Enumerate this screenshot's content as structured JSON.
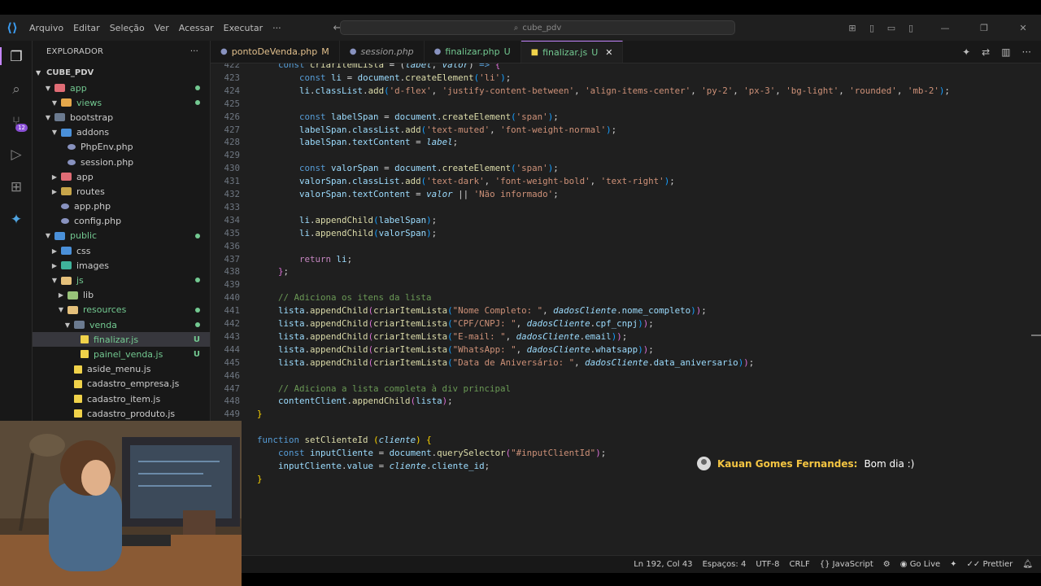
{
  "window": {
    "menu": [
      "Arquivo",
      "Editar",
      "Seleção",
      "Ver",
      "Acessar",
      "Executar",
      "···"
    ],
    "search_text": "cube_pdv"
  },
  "activity_bar": {
    "source_control_badge": "12",
    "icons": [
      "explorer-icon",
      "search-icon",
      "source-control-icon",
      "run-debug-icon",
      "extensions-icon",
      "copilot-icon"
    ]
  },
  "sidebar": {
    "title": "EXPLORADOR",
    "more": "···",
    "root": "CUBE_PDV",
    "items": [
      {
        "label": "app",
        "depth": 1,
        "type": "folder-open",
        "color": "#e06c75",
        "git": true,
        "status": "dot"
      },
      {
        "label": "views",
        "depth": 2,
        "type": "folder-open",
        "color": "#e5a84b",
        "git": true,
        "status": "dot"
      },
      {
        "label": "bootstrap",
        "depth": 1,
        "type": "folder-open",
        "color": "#6b7a8f",
        "git": false,
        "status": ""
      },
      {
        "label": "addons",
        "depth": 2,
        "type": "folder-open",
        "color": "#4a90d9",
        "git": false,
        "status": ""
      },
      {
        "label": "PhpEnv.php",
        "depth": 3,
        "type": "php",
        "color": "#8892bf",
        "git": false,
        "status": ""
      },
      {
        "label": "session.php",
        "depth": 3,
        "type": "php",
        "color": "#8892bf",
        "git": false,
        "status": ""
      },
      {
        "label": "app",
        "depth": 2,
        "type": "folder",
        "color": "#e06c75",
        "git": false,
        "status": ""
      },
      {
        "label": "routes",
        "depth": 2,
        "type": "folder",
        "color": "#c7a54a",
        "git": false,
        "status": ""
      },
      {
        "label": "app.php",
        "depth": 2,
        "type": "php",
        "color": "#8892bf",
        "git": false,
        "status": ""
      },
      {
        "label": "config.php",
        "depth": 2,
        "type": "php",
        "color": "#8892bf",
        "git": false,
        "status": ""
      },
      {
        "label": "public",
        "depth": 1,
        "type": "folder-open",
        "color": "#4a90d9",
        "git": true,
        "status": "dot"
      },
      {
        "label": "css",
        "depth": 2,
        "type": "folder",
        "color": "#4a90d9",
        "git": false,
        "status": ""
      },
      {
        "label": "images",
        "depth": 2,
        "type": "folder",
        "color": "#3fb39b",
        "git": false,
        "status": ""
      },
      {
        "label": "js",
        "depth": 2,
        "type": "folder-open",
        "color": "#e5c07b",
        "git": true,
        "status": "dot"
      },
      {
        "label": "lib",
        "depth": 3,
        "type": "folder",
        "color": "#98c379",
        "git": false,
        "status": ""
      },
      {
        "label": "resources",
        "depth": 3,
        "type": "folder-open",
        "color": "#e5c07b",
        "git": true,
        "status": "dot"
      },
      {
        "label": "venda",
        "depth": 4,
        "type": "folder-open",
        "color": "#6b7a8f",
        "git": true,
        "status": "dot"
      },
      {
        "label": "finalizar.js",
        "depth": 5,
        "type": "js",
        "color": "#f0d24a",
        "git": true,
        "status": "U",
        "selected": true
      },
      {
        "label": "painel_venda.js",
        "depth": 5,
        "type": "js",
        "color": "#f0d24a",
        "git": true,
        "status": "U"
      },
      {
        "label": "aside_menu.js",
        "depth": 4,
        "type": "js",
        "color": "#f0d24a",
        "git": false,
        "status": ""
      },
      {
        "label": "cadastro_empresa.js",
        "depth": 4,
        "type": "js",
        "color": "#f0d24a",
        "git": false,
        "status": ""
      },
      {
        "label": "cadastro_item.js",
        "depth": 4,
        "type": "js",
        "color": "#f0d24a",
        "git": false,
        "status": ""
      },
      {
        "label": "cadastro_produto.js",
        "depth": 4,
        "type": "js",
        "color": "#f0d24a",
        "git": false,
        "status": ""
      }
    ]
  },
  "tabs": [
    {
      "label": "pontoDeVenda.php",
      "status": "M",
      "italic": false,
      "active": false,
      "icon_color": "#8892bf"
    },
    {
      "label": "session.php",
      "status": "",
      "italic": true,
      "active": false,
      "icon_color": "#8892bf"
    },
    {
      "label": "finalizar.php",
      "status": "U",
      "italic": false,
      "active": false,
      "icon_color": "#8892bf"
    },
    {
      "label": "finalizar.js",
      "status": "U",
      "italic": false,
      "active": true,
      "icon_color": "#f0d24a",
      "close": "✕"
    }
  ],
  "code": [
    {
      "n": "422",
      "html": "    <span class=\"kw\">const</span> <span class=\"fn\">criarItemLista</span> <span class=\"pl\">= (</span><span class=\"it\">label</span><span class=\"pl\">, </span><span class=\"it\">valor</span><span class=\"pl\">) </span><span class=\"kw\">=&gt;</span> <span class=\"br2\">{</span>"
    },
    {
      "n": "423",
      "html": "        <span class=\"kw\">const</span> <span class=\"var\">li</span> <span class=\"pl\">=</span> <span class=\"var\">document</span><span class=\"pl\">.</span><span class=\"fn\">createElement</span><span class=\"br3\">(</span><span class=\"str\">'li'</span><span class=\"br3\">)</span><span class=\"pl\">;</span>"
    },
    {
      "n": "424",
      "html": "        <span class=\"var\">li</span><span class=\"pl\">.</span><span class=\"var\">classList</span><span class=\"pl\">.</span><span class=\"fn\">add</span><span class=\"br3\">(</span><span class=\"str\">'d-flex'</span><span class=\"pl\">, </span><span class=\"str\">'justify-content-between'</span><span class=\"pl\">, </span><span class=\"str\">'align-items-center'</span><span class=\"pl\">, </span><span class=\"str\">'py-2'</span><span class=\"pl\">, </span><span class=\"str\">'px-3'</span><span class=\"pl\">, </span><span class=\"str\">'bg-light'</span><span class=\"pl\">, </span><span class=\"str\">'rounded'</span><span class=\"pl\">, </span><span class=\"str\">'mb-2'</span><span class=\"br3\">)</span><span class=\"pl\">;</span>"
    },
    {
      "n": "425",
      "html": ""
    },
    {
      "n": "426",
      "html": "        <span class=\"kw\">const</span> <span class=\"var\">labelSpan</span> <span class=\"pl\">=</span> <span class=\"var\">document</span><span class=\"pl\">.</span><span class=\"fn\">createElement</span><span class=\"br3\">(</span><span class=\"str\">'span'</span><span class=\"br3\">)</span><span class=\"pl\">;</span>"
    },
    {
      "n": "427",
      "html": "        <span class=\"var\">labelSpan</span><span class=\"pl\">.</span><span class=\"var\">classList</span><span class=\"pl\">.</span><span class=\"fn\">add</span><span class=\"br3\">(</span><span class=\"str\">'text-muted'</span><span class=\"pl\">, </span><span class=\"str\">'font-weight-normal'</span><span class=\"br3\">)</span><span class=\"pl\">;</span>"
    },
    {
      "n": "428",
      "html": "        <span class=\"var\">labelSpan</span><span class=\"pl\">.</span><span class=\"var\">textContent</span> <span class=\"pl\">=</span> <span class=\"it\">label</span><span class=\"pl\">;</span>"
    },
    {
      "n": "429",
      "html": ""
    },
    {
      "n": "430",
      "html": "        <span class=\"kw\">const</span> <span class=\"var\">valorSpan</span> <span class=\"pl\">=</span> <span class=\"var\">document</span><span class=\"pl\">.</span><span class=\"fn\">createElement</span><span class=\"br3\">(</span><span class=\"str\">'span'</span><span class=\"br3\">)</span><span class=\"pl\">;</span>"
    },
    {
      "n": "431",
      "html": "        <span class=\"var\">valorSpan</span><span class=\"pl\">.</span><span class=\"var\">classList</span><span class=\"pl\">.</span><span class=\"fn\">add</span><span class=\"br3\">(</span><span class=\"str\">'text-dark'</span><span class=\"pl\">, </span><span class=\"str\">'font-weight-bold'</span><span class=\"pl\">, </span><span class=\"str\">'text-right'</span><span class=\"br3\">)</span><span class=\"pl\">;</span>"
    },
    {
      "n": "432",
      "html": "        <span class=\"var\">valorSpan</span><span class=\"pl\">.</span><span class=\"var\">textContent</span> <span class=\"pl\">=</span> <span class=\"it\">valor</span> <span class=\"pl\">||</span> <span class=\"str\">'Não informado'</span><span class=\"pl\">;</span>"
    },
    {
      "n": "433",
      "html": ""
    },
    {
      "n": "434",
      "html": "        <span class=\"var\">li</span><span class=\"pl\">.</span><span class=\"fn\">appendChild</span><span class=\"br3\">(</span><span class=\"var\">labelSpan</span><span class=\"br3\">)</span><span class=\"pl\">;</span>"
    },
    {
      "n": "435",
      "html": "        <span class=\"var\">li</span><span class=\"pl\">.</span><span class=\"fn\">appendChild</span><span class=\"br3\">(</span><span class=\"var\">valorSpan</span><span class=\"br3\">)</span><span class=\"pl\">;</span>"
    },
    {
      "n": "436",
      "html": ""
    },
    {
      "n": "437",
      "html": "        <span class=\"ctl\">return</span> <span class=\"var\">li</span><span class=\"pl\">;</span>"
    },
    {
      "n": "438",
      "html": "    <span class=\"br2\">}</span><span class=\"pl\">;</span>"
    },
    {
      "n": "439",
      "html": ""
    },
    {
      "n": "440",
      "html": "    <span class=\"cm\">// Adiciona os itens da lista</span>"
    },
    {
      "n": "441",
      "html": "    <span class=\"var\">lista</span><span class=\"pl\">.</span><span class=\"fn\">appendChild</span><span class=\"br2\">(</span><span class=\"fn\">criarItemLista</span><span class=\"br3\">(</span><span class=\"str\">\"Nome Completo: \"</span><span class=\"pl\">, </span><span class=\"it\">dadosCliente</span><span class=\"pl\">.</span><span class=\"var\">nome_completo</span><span class=\"br3\">)</span><span class=\"br2\">)</span><span class=\"pl\">;</span>"
    },
    {
      "n": "442",
      "html": "    <span class=\"var\">lista</span><span class=\"pl\">.</span><span class=\"fn\">appendChild</span><span class=\"br2\">(</span><span class=\"fn\">criarItemLista</span><span class=\"br3\">(</span><span class=\"str\">\"CPF/CNPJ: \"</span><span class=\"pl\">, </span><span class=\"it\">dadosCliente</span><span class=\"pl\">.</span><span class=\"var\">cpf_cnpj</span><span class=\"br3\">)</span><span class=\"br2\">)</span><span class=\"pl\">;</span>"
    },
    {
      "n": "443",
      "html": "    <span class=\"var\">lista</span><span class=\"pl\">.</span><span class=\"fn\">appendChild</span><span class=\"br2\">(</span><span class=\"fn\">criarItemLista</span><span class=\"br3\">(</span><span class=\"str\">\"E-mail: \"</span><span class=\"pl\">, </span><span class=\"it\">dadosCliente</span><span class=\"pl\">.</span><span class=\"var\">email</span><span class=\"br3\">)</span><span class=\"br2\">)</span><span class=\"pl\">;</span>"
    },
    {
      "n": "444",
      "html": "    <span class=\"var\">lista</span><span class=\"pl\">.</span><span class=\"fn\">appendChild</span><span class=\"br2\">(</span><span class=\"fn\">criarItemLista</span><span class=\"br3\">(</span><span class=\"str\">\"WhatsApp: \"</span><span class=\"pl\">, </span><span class=\"it\">dadosCliente</span><span class=\"pl\">.</span><span class=\"var\">whatsapp</span><span class=\"br3\">)</span><span class=\"br2\">)</span><span class=\"pl\">;</span>"
    },
    {
      "n": "445",
      "html": "    <span class=\"var\">lista</span><span class=\"pl\">.</span><span class=\"fn\">appendChild</span><span class=\"br2\">(</span><span class=\"fn\">criarItemLista</span><span class=\"br3\">(</span><span class=\"str\">\"Data de Aniversário: \"</span><span class=\"pl\">, </span><span class=\"it\">dadosCliente</span><span class=\"pl\">.</span><span class=\"var\">data_aniversario</span><span class=\"br3\">)</span><span class=\"br2\">)</span><span class=\"pl\">;</span>"
    },
    {
      "n": "446",
      "html": ""
    },
    {
      "n": "447",
      "html": "    <span class=\"cm\">// Adiciona a lista completa à div principal</span>"
    },
    {
      "n": "448",
      "html": "    <span class=\"var\">contentClient</span><span class=\"pl\">.</span><span class=\"fn\">appendChild</span><span class=\"br2\">(</span><span class=\"var\">lista</span><span class=\"br2\">)</span><span class=\"pl\">;</span>"
    },
    {
      "n": "449",
      "html": "<span class=\"br\">}</span>"
    },
    {
      "n": "",
      "html": ""
    },
    {
      "n": "",
      "html": "<span class=\"kw\">function</span> <span class=\"fn\">setClienteId</span> <span class=\"br\">(</span><span class=\"it\">cliente</span><span class=\"br\">)</span> <span class=\"br\">{</span>"
    },
    {
      "n": "",
      "html": "    <span class=\"kw\">const</span> <span class=\"var\">inputCliente</span> <span class=\"pl\">=</span> <span class=\"var\">document</span><span class=\"pl\">.</span><span class=\"fn\">querySelector</span><span class=\"br2\">(</span><span class=\"str\">\"#inputClientId\"</span><span class=\"br2\">)</span><span class=\"pl\">;</span>"
    },
    {
      "n": "",
      "html": "    <span class=\"var\">inputCliente</span><span class=\"pl\">.</span><span class=\"var\">value</span> <span class=\"pl\">=</span> <span class=\"it\">cliente</span><span class=\"pl\">.</span><span class=\"var\">cliente_id</span><span class=\"pl\">;</span>"
    },
    {
      "n": "",
      "html": "<span class=\"br\">}</span>"
    }
  ],
  "chat": {
    "name": "Kauan Gomes Fernandes:",
    "message": "Bom dia :)"
  },
  "status_bar": {
    "position": "Ln 192, Col 43",
    "spaces": "Espaços: 4",
    "encoding": "UTF-8",
    "eol": "CRLF",
    "language": "JavaScript",
    "go_live": "Go Live",
    "prettier": "Prettier"
  }
}
